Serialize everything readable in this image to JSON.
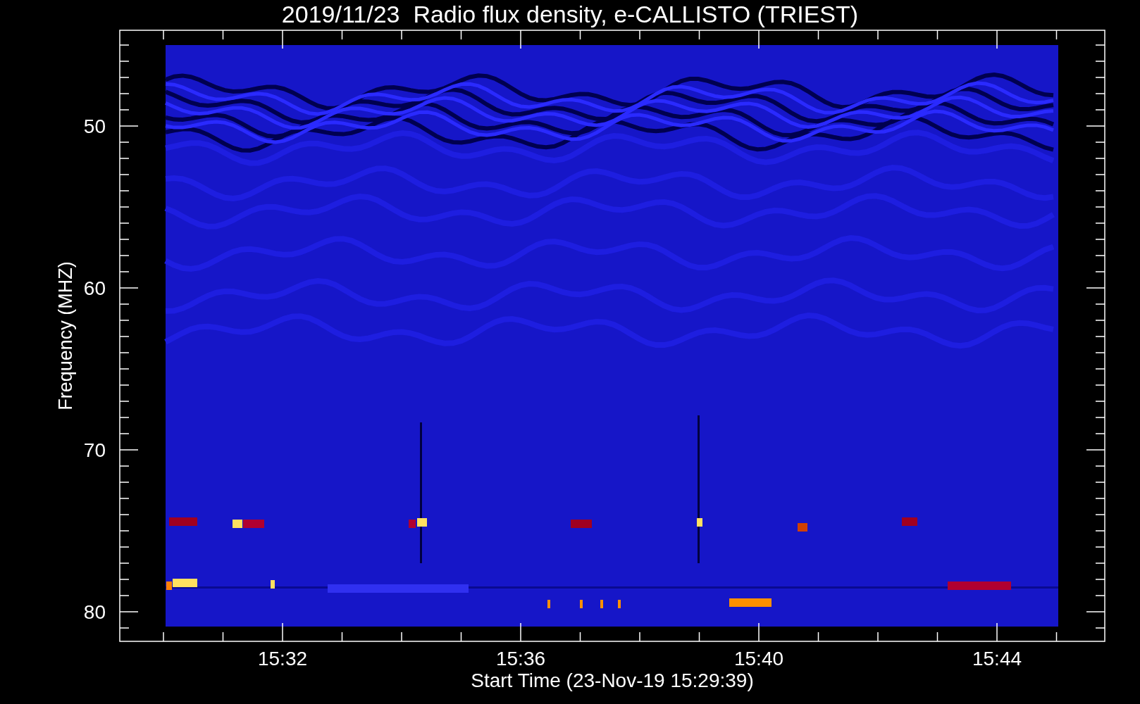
{
  "title": "2019/11/23  Radio flux density, e-CALLISTO (TRIEST)",
  "y_axis": {
    "label": "Frequency (MHZ)",
    "ticks": [
      "50",
      "60",
      "70",
      "80"
    ]
  },
  "x_axis": {
    "label": "Start Time (23-Nov-19 15:29:39)",
    "ticks": [
      "15:32",
      "15:36",
      "15:40",
      "15:44"
    ]
  }
}
